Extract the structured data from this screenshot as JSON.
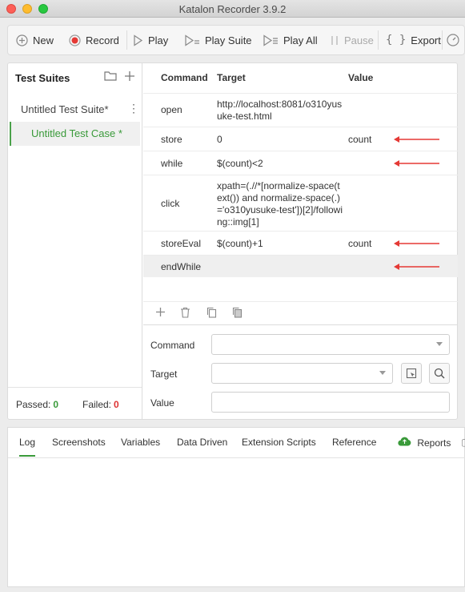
{
  "window": {
    "title": "Katalon Recorder 3.9.2"
  },
  "toolbar": {
    "new": "New",
    "record": "Record",
    "play": "Play",
    "play_suite": "Play Suite",
    "play_all": "Play All",
    "pause": "Pause",
    "export": "Export"
  },
  "sidebar": {
    "title": "Test Suites",
    "suite": "Untitled Test Suite*",
    "case": "Untitled Test Case *",
    "passed_label": "Passed:",
    "passed_value": "0",
    "failed_label": "Failed:",
    "failed_value": "0"
  },
  "table": {
    "headers": {
      "command": "Command",
      "target": "Target",
      "value": "Value"
    },
    "rows": [
      {
        "command": "open",
        "target": "http://localhost:8081/o310yusuke-test.html",
        "value": ""
      },
      {
        "command": "store",
        "target": "0",
        "value": "count"
      },
      {
        "command": "while",
        "target": "$(count)<2",
        "value": ""
      },
      {
        "command": "click",
        "target": "xpath=(.//*[normalize-space(text()) and normalize-space(.)='o310yusuke-test'])[2]/following::img[1]",
        "value": ""
      },
      {
        "command": "storeEval",
        "target": "$(count)+1",
        "value": "count"
      },
      {
        "command": "endWhile",
        "target": "",
        "value": ""
      }
    ],
    "arrow_color": "#e53935"
  },
  "editor": {
    "command_label": "Command",
    "target_label": "Target",
    "value_label": "Value",
    "command_value": "",
    "target_value": "",
    "value_value": ""
  },
  "bottom_tabs": [
    "Log",
    "Screenshots",
    "Variables",
    "Data Driven",
    "Extension Scripts",
    "Reference",
    "Reports"
  ],
  "colors": {
    "accent_green": "#3a9a3a",
    "fail_red": "#d33",
    "record_red": "#e53935"
  }
}
